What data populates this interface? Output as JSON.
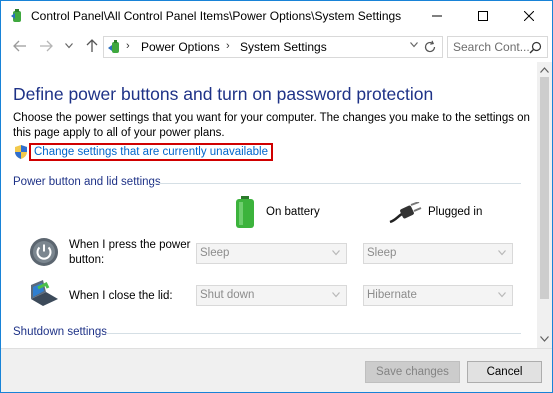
{
  "window": {
    "title": "Control Panel\\All Control Panel Items\\Power Options\\System Settings",
    "controls": {
      "minimize": "minimize",
      "maximize": "maximize",
      "close": "close"
    }
  },
  "nav": {
    "breadcrumbs": [
      "Power Options",
      "System Settings"
    ],
    "separator": "›",
    "search_placeholder": "Search Cont..."
  },
  "main": {
    "title": "Define power buttons and turn on password protection",
    "description": "Choose the power settings that you want for your computer. The changes you make to the settings on this page apply to all of your power plans.",
    "change_link": "Change settings that are currently unavailable",
    "section_power": "Power button and lid settings",
    "section_shutdown": "Shutdown settings",
    "columns": {
      "battery": "On battery",
      "plugged": "Plugged in"
    },
    "rows": [
      {
        "label": "When I press the power button:",
        "battery": "Sleep",
        "plugged": "Sleep"
      },
      {
        "label": "When I close the lid:",
        "battery": "Shut down",
        "plugged": "Hibernate"
      }
    ]
  },
  "footer": {
    "save": "Save changes",
    "cancel": "Cancel"
  },
  "colors": {
    "accent": "#1e3287",
    "link": "#0066cc",
    "highlight_border": "#d00000",
    "window_border": "#1883d7"
  }
}
